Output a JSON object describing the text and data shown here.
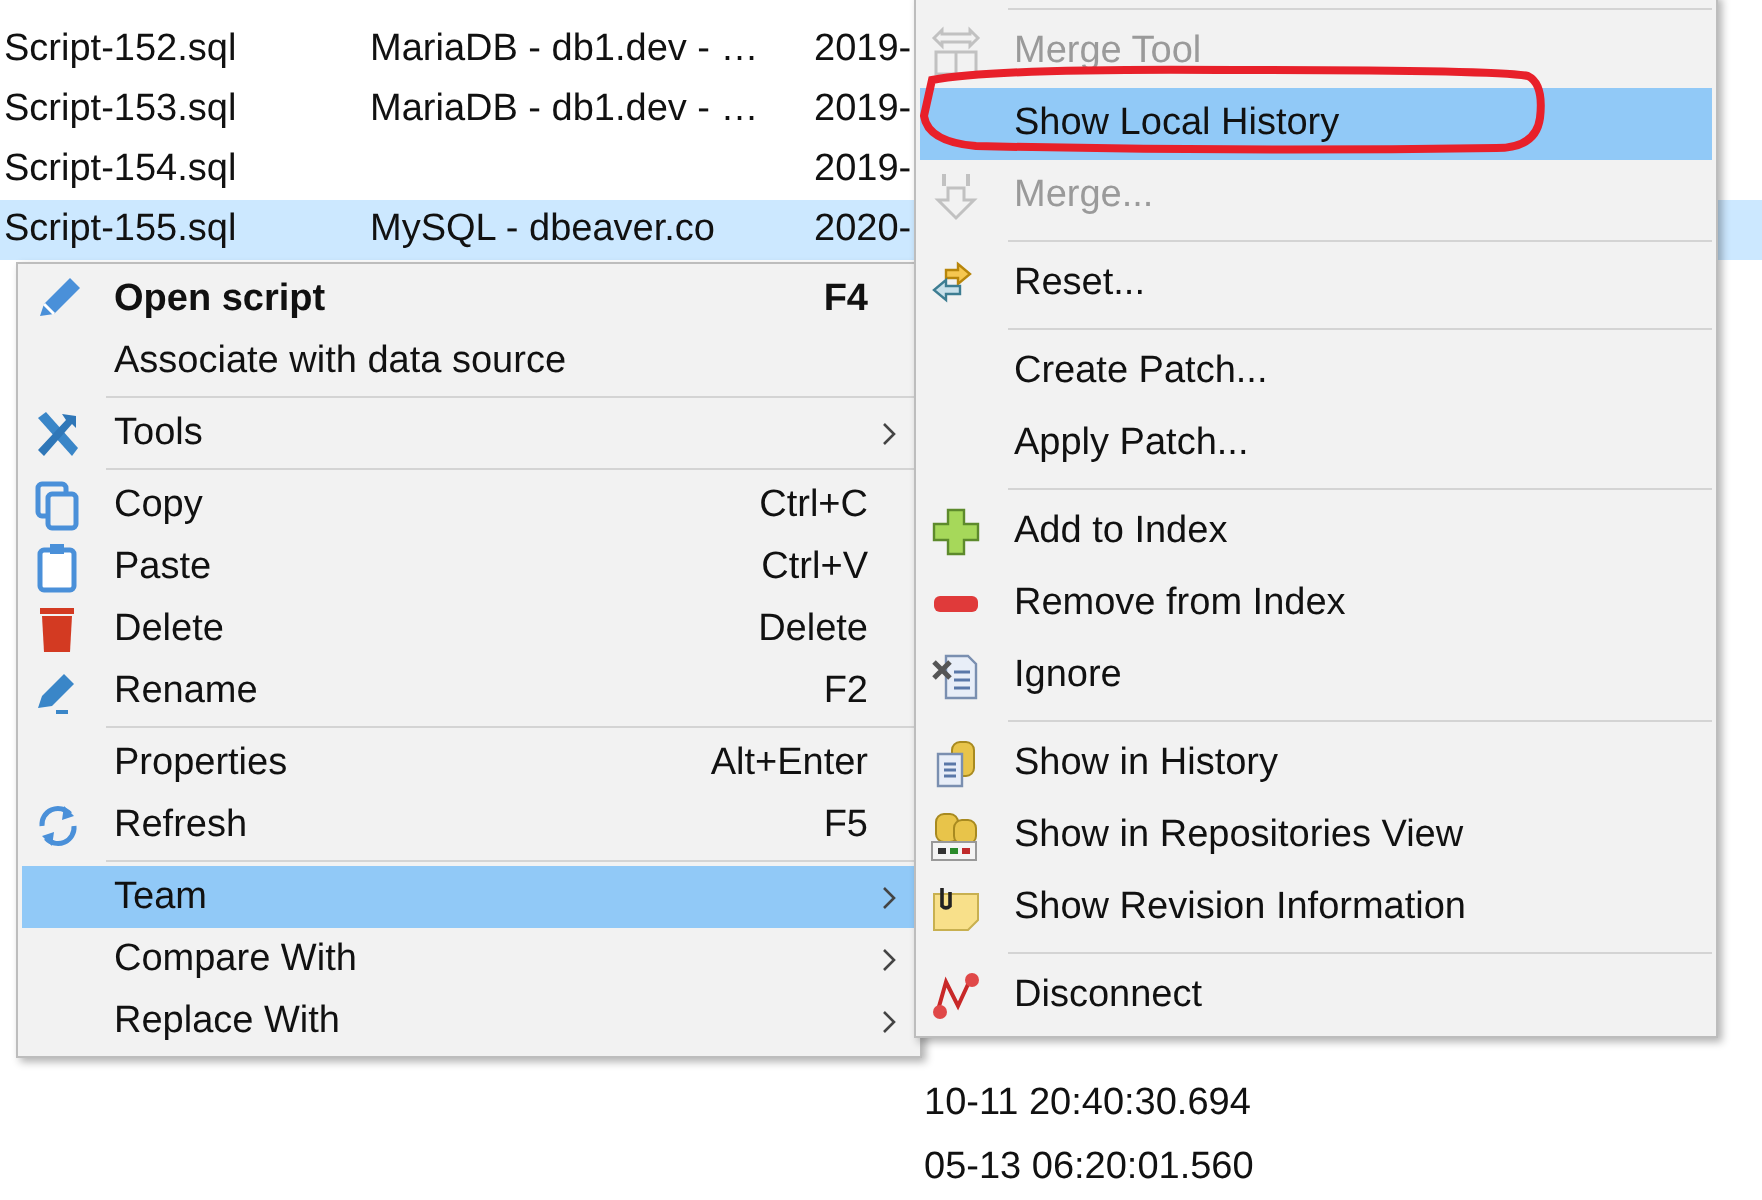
{
  "table": {
    "rows": [
      {
        "kind": "full",
        "selected": false,
        "cells": [
          "Script-152.sql",
          "MariaDB - db1.dev - …",
          "2019-"
        ]
      },
      {
        "kind": "full",
        "selected": false,
        "cells": [
          "Script-153.sql",
          "MariaDB - db1.dev - …",
          "2019-"
        ]
      },
      {
        "kind": "full",
        "selected": false,
        "cells": [
          "Script-154.sql",
          "",
          "2019-"
        ]
      },
      {
        "kind": "full",
        "selected": true,
        "cells": [
          "Script-155.sql",
          "MySQL - dbeaver.co",
          "2020-"
        ]
      },
      {
        "kind": "partial",
        "selected": false,
        "cells": [
          "10-11 20:40:30.694"
        ]
      },
      {
        "kind": "partial",
        "selected": false,
        "cells": [
          "05-13 06:20:01.560"
        ]
      }
    ]
  },
  "context_menu": {
    "items": [
      {
        "kind": "item",
        "label": "Open script",
        "shortcut": "F4",
        "default": true,
        "selected": false,
        "submenu": false
      },
      {
        "kind": "item",
        "label": "Associate with data source",
        "selected": false,
        "submenu": false
      },
      {
        "kind": "separator"
      },
      {
        "kind": "item",
        "label": "Tools",
        "selected": false,
        "submenu": true
      },
      {
        "kind": "separator"
      },
      {
        "kind": "item",
        "label": "Copy",
        "shortcut": "Ctrl+C",
        "selected": false,
        "submenu": false
      },
      {
        "kind": "item",
        "label": "Paste",
        "shortcut": "Ctrl+V",
        "selected": false,
        "submenu": false
      },
      {
        "kind": "item",
        "label": "Delete",
        "shortcut": "Delete",
        "selected": false,
        "submenu": false
      },
      {
        "kind": "item",
        "label": "Rename",
        "shortcut": "F2",
        "selected": false,
        "submenu": false
      },
      {
        "kind": "separator"
      },
      {
        "kind": "item",
        "label": "Properties",
        "shortcut": "Alt+Enter",
        "selected": false,
        "submenu": false
      },
      {
        "kind": "item",
        "label": "Refresh",
        "shortcut": "F5",
        "selected": false,
        "submenu": false
      },
      {
        "kind": "separator"
      },
      {
        "kind": "item",
        "label": "Team",
        "selected": true,
        "submenu": true
      },
      {
        "kind": "item",
        "label": "Compare With",
        "selected": false,
        "submenu": true
      },
      {
        "kind": "item",
        "label": "Replace With",
        "selected": false,
        "submenu": true
      }
    ]
  },
  "team_submenu": {
    "items": [
      {
        "kind": "separator"
      },
      {
        "kind": "item",
        "label": "Merge Tool",
        "disabled": true,
        "selected": false
      },
      {
        "kind": "item",
        "label": "Show Local History",
        "disabled": false,
        "selected": true
      },
      {
        "kind": "item",
        "label": "Merge...",
        "disabled": true,
        "selected": false
      },
      {
        "kind": "separator"
      },
      {
        "kind": "item",
        "label": "Reset...",
        "disabled": false,
        "selected": false
      },
      {
        "kind": "separator"
      },
      {
        "kind": "item",
        "label": "Create Patch...",
        "disabled": false,
        "selected": false
      },
      {
        "kind": "item",
        "label": "Apply Patch...",
        "disabled": false,
        "selected": false
      },
      {
        "kind": "separator"
      },
      {
        "kind": "item",
        "label": "Add to Index",
        "disabled": false,
        "selected": false
      },
      {
        "kind": "item",
        "label": "Remove from Index",
        "disabled": false,
        "selected": false
      },
      {
        "kind": "item",
        "label": "Ignore",
        "disabled": false,
        "selected": false
      },
      {
        "kind": "separator"
      },
      {
        "kind": "item",
        "label": "Show in History",
        "disabled": false,
        "selected": false
      },
      {
        "kind": "item",
        "label": "Show in Repositories View",
        "disabled": false,
        "selected": false
      },
      {
        "kind": "item",
        "label": "Show Revision Information",
        "disabled": false,
        "selected": false
      },
      {
        "kind": "separator"
      },
      {
        "kind": "item",
        "label": "Disconnect",
        "disabled": false,
        "selected": false
      }
    ]
  }
}
